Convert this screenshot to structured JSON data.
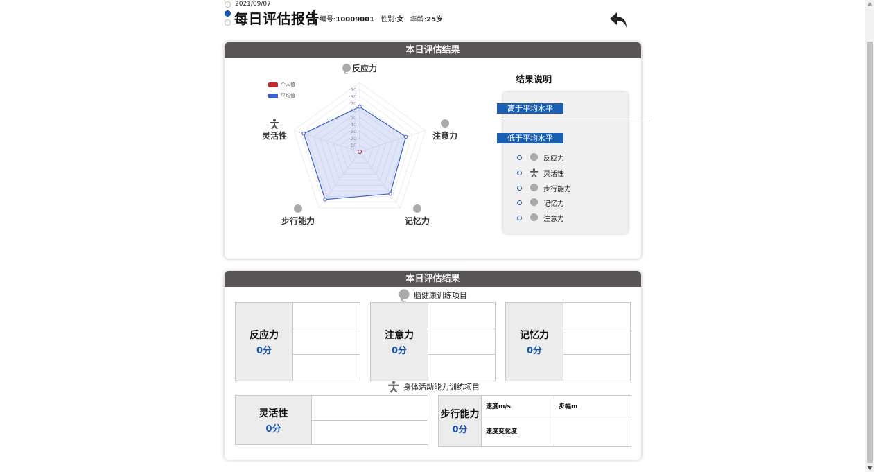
{
  "header": {
    "date": "2021/09/07",
    "title": "每日评估报告",
    "id_label": "编号:",
    "id_value": "10009001",
    "gender_label": "性别:",
    "gender_value": "女",
    "age_label": "年龄:",
    "age_value": "25岁"
  },
  "card1": {
    "title": "本日评估结果",
    "radar": {
      "axes": [
        "反应力",
        "注意力",
        "记忆力",
        "步行能力",
        "灵活性"
      ],
      "legend": [
        {
          "name": "个人值",
          "color": "#c0282c"
        },
        {
          "name": "平均值",
          "color": "#3a5fcd"
        }
      ],
      "ticks": [
        "90",
        "80",
        "70",
        "60",
        "50",
        "40",
        "30",
        "20",
        "10"
      ]
    },
    "explain": {
      "title": "结果说明",
      "above": "高于平均水平",
      "below": "低于平均水平",
      "below_items": [
        {
          "label": "反应力",
          "icon": "brain-icon"
        },
        {
          "label": "灵活性",
          "icon": "person-icon"
        },
        {
          "label": "步行能力",
          "icon": "brain-icon"
        },
        {
          "label": "记忆力",
          "icon": "brain-icon"
        },
        {
          "label": "注意力",
          "icon": "brain-icon"
        }
      ]
    }
  },
  "chart_data": {
    "type": "radar",
    "categories": [
      "反应力",
      "注意力",
      "记忆力",
      "步行能力",
      "灵活性"
    ],
    "ylim": [
      0,
      100
    ],
    "series": [
      {
        "name": "个人值",
        "color": "#c0282c",
        "values": [
          0,
          0,
          0,
          0,
          0
        ]
      },
      {
        "name": "平均值",
        "color": "#3a5fcd",
        "values": [
          65,
          70,
          75,
          85,
          85
        ]
      }
    ]
  },
  "card2": {
    "title": "本日评估结果",
    "brain_section": "脑健康训练项目",
    "body_section": "身体活动能力训练项目",
    "scores": {
      "reaction": {
        "name": "反应力",
        "value": "0分"
      },
      "attention": {
        "name": "注意力",
        "value": "0分"
      },
      "memory": {
        "name": "记忆力",
        "value": "0分"
      },
      "flexibility": {
        "name": "灵活性",
        "value": "0分"
      },
      "walking": {
        "name": "步行能力",
        "value": "0分"
      }
    },
    "walking_metrics": {
      "speed": "速度m/s",
      "stride": "步幅m",
      "speed_change": "速度变化度"
    }
  }
}
